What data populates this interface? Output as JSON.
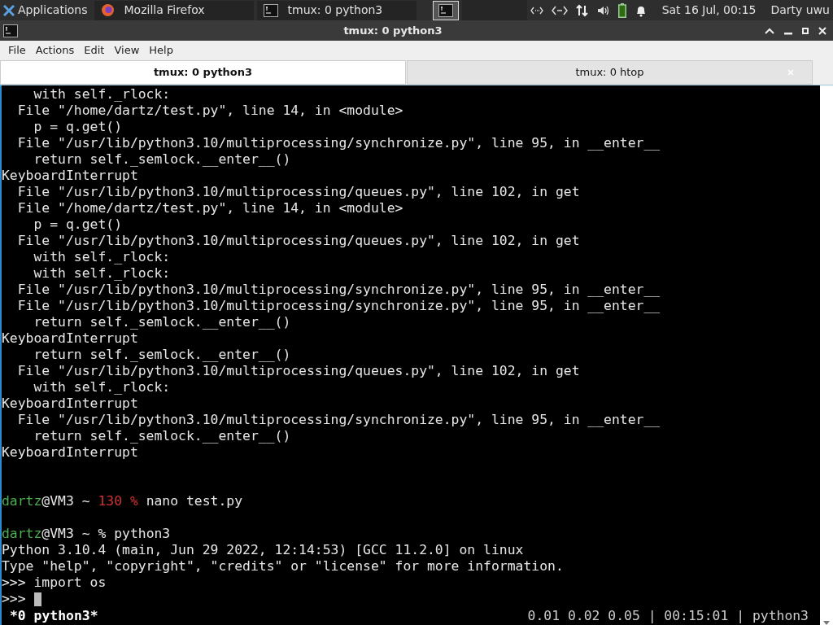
{
  "panel": {
    "applications": "Applications",
    "tasks": [
      {
        "label": "Mozilla Firefox",
        "kind": "browser",
        "selected": false
      },
      {
        "label": "tmux: 0 python3",
        "kind": "terminal",
        "selected": false
      }
    ],
    "clock": "Sat 16 Jul, 00:15",
    "user": "Darty uwu"
  },
  "window": {
    "title": "tmux: 0 python3"
  },
  "menu": [
    "File",
    "Actions",
    "Edit",
    "View",
    "Help"
  ],
  "tabs": [
    {
      "label": "tmux: 0 python3",
      "selected": true
    },
    {
      "label": "tmux: 0 htop",
      "selected": false
    }
  ],
  "terminal": {
    "lines": [
      {
        "segments": [
          {
            "text": "    with self._rlock:",
            "kind": "plain"
          }
        ]
      },
      {
        "segments": [
          {
            "text": "  File \"/home/dartz/test.py\", line 14, in <module>",
            "kind": "plain"
          }
        ]
      },
      {
        "segments": [
          {
            "text": "    p = q.get()",
            "kind": "plain"
          }
        ]
      },
      {
        "segments": [
          {
            "text": "  File \"/usr/lib/python3.10/multiprocessing/synchronize.py\", line 95, in __enter__",
            "kind": "plain"
          }
        ]
      },
      {
        "segments": [
          {
            "text": "    return self._semlock.__enter__()",
            "kind": "plain"
          }
        ]
      },
      {
        "segments": [
          {
            "text": "KeyboardInterrupt",
            "kind": "plain"
          }
        ]
      },
      {
        "segments": [
          {
            "text": "  File \"/usr/lib/python3.10/multiprocessing/queues.py\", line 102, in get",
            "kind": "plain"
          }
        ]
      },
      {
        "segments": [
          {
            "text": "  File \"/home/dartz/test.py\", line 14, in <module>",
            "kind": "plain"
          }
        ]
      },
      {
        "segments": [
          {
            "text": "    p = q.get()",
            "kind": "plain"
          }
        ]
      },
      {
        "segments": [
          {
            "text": "  File \"/usr/lib/python3.10/multiprocessing/queues.py\", line 102, in get",
            "kind": "plain"
          }
        ]
      },
      {
        "segments": [
          {
            "text": "    with self._rlock:",
            "kind": "plain"
          }
        ]
      },
      {
        "segments": [
          {
            "text": "    with self._rlock:",
            "kind": "plain"
          }
        ]
      },
      {
        "segments": [
          {
            "text": "  File \"/usr/lib/python3.10/multiprocessing/synchronize.py\", line 95, in __enter__",
            "kind": "plain"
          }
        ]
      },
      {
        "segments": [
          {
            "text": "  File \"/usr/lib/python3.10/multiprocessing/synchronize.py\", line 95, in __enter__",
            "kind": "plain"
          }
        ]
      },
      {
        "segments": [
          {
            "text": "    return self._semlock.__enter__()",
            "kind": "plain"
          }
        ]
      },
      {
        "segments": [
          {
            "text": "KeyboardInterrupt",
            "kind": "plain"
          }
        ]
      },
      {
        "segments": [
          {
            "text": "    return self._semlock.__enter__()",
            "kind": "plain"
          }
        ]
      },
      {
        "segments": [
          {
            "text": "  File \"/usr/lib/python3.10/multiprocessing/queues.py\", line 102, in get",
            "kind": "plain"
          }
        ]
      },
      {
        "segments": [
          {
            "text": "    with self._rlock:",
            "kind": "plain"
          }
        ]
      },
      {
        "segments": [
          {
            "text": "KeyboardInterrupt",
            "kind": "plain"
          }
        ]
      },
      {
        "segments": [
          {
            "text": "  File \"/usr/lib/python3.10/multiprocessing/synchronize.py\", line 95, in __enter__",
            "kind": "plain"
          }
        ]
      },
      {
        "segments": [
          {
            "text": "    return self._semlock.__enter__()",
            "kind": "plain"
          }
        ]
      },
      {
        "segments": [
          {
            "text": "KeyboardInterrupt",
            "kind": "plain"
          }
        ]
      },
      {
        "kind": "blank"
      },
      {
        "kind": "blank"
      },
      {
        "segments": [
          {
            "text": "dartz",
            "kind": "user"
          },
          {
            "text": "@VM3 ~ ",
            "kind": "plain"
          },
          {
            "text": "130 %",
            "kind": "error"
          },
          {
            "text": " nano test.py",
            "kind": "plain"
          }
        ]
      },
      {
        "kind": "blank"
      },
      {
        "segments": [
          {
            "text": "dartz",
            "kind": "user"
          },
          {
            "text": "@VM3 ~ % python3",
            "kind": "plain"
          }
        ]
      },
      {
        "segments": [
          {
            "text": "Python 3.10.4 (main, Jun 29 2022, 12:14:53) [GCC 11.2.0] on linux",
            "kind": "plain"
          }
        ]
      },
      {
        "segments": [
          {
            "text": "Type \"help\", \"copyright\", \"credits\" or \"license\" for more information.",
            "kind": "plain"
          }
        ]
      },
      {
        "segments": [
          {
            "text": ">>> import os",
            "kind": "plain"
          }
        ]
      },
      {
        "segments": [
          {
            "text": ">>>",
            "kind": "plain"
          }
        ],
        "cursor": true
      }
    ],
    "status": {
      "window": "*0 python3*",
      "right": "0.01 0.02 0.05 | 00:15:01 | python3"
    }
  }
}
